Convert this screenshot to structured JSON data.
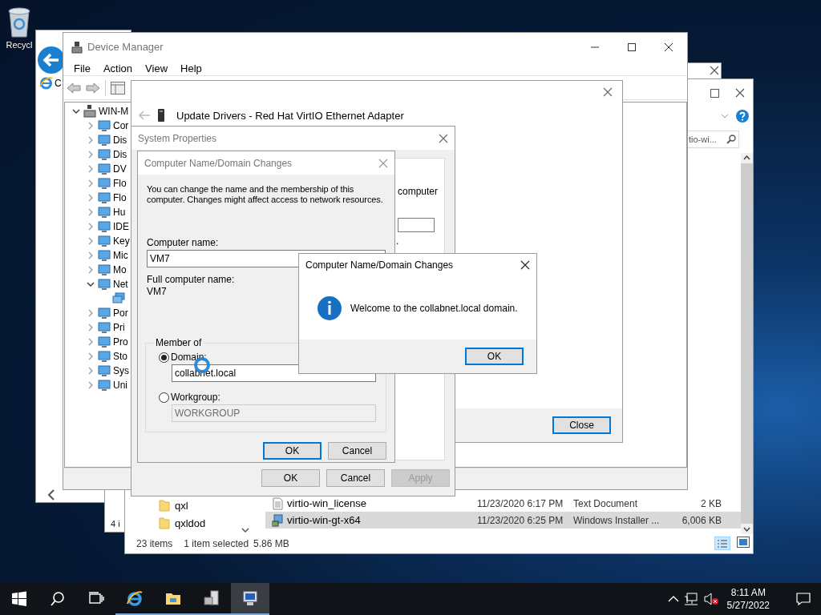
{
  "desktop": {
    "icons": [
      {
        "label": "Recycl"
      }
    ]
  },
  "back_window": {
    "address_text": "C"
  },
  "middle_window": {
    "status_text": "4 i"
  },
  "explorer": {
    "search_text": "tio-wi...",
    "folders": [
      {
        "name": "qxl"
      },
      {
        "name": "qxldod"
      }
    ],
    "files": [
      {
        "name": "virtio-win_license",
        "date": "11/23/2020 6:17 PM",
        "type": "Text Document",
        "size": "2 KB",
        "kind": "document",
        "selected": false
      },
      {
        "name": "virtio-win-gt-x64",
        "date": "11/23/2020 6:25 PM",
        "type": "Windows Installer ...",
        "size": "6,006 KB",
        "kind": "installer",
        "selected": true
      }
    ],
    "status": {
      "items": "23 items",
      "selection": "1 item selected",
      "size": "5.86 MB"
    }
  },
  "device_manager": {
    "title": "Device Manager",
    "menu": [
      "File",
      "Action",
      "View",
      "Help"
    ],
    "tree": {
      "label": "WIN-M",
      "kind": "computer",
      "expanded": true,
      "children": [
        {
          "label": "Cor",
          "kind": "category",
          "expanded": false
        },
        {
          "label": "Dis",
          "kind": "category",
          "expanded": false
        },
        {
          "label": "Dis",
          "kind": "category",
          "expanded": false
        },
        {
          "label": "DV",
          "kind": "category",
          "expanded": false
        },
        {
          "label": "Flo",
          "kind": "category",
          "expanded": false
        },
        {
          "label": "Flo",
          "kind": "category",
          "expanded": false
        },
        {
          "label": "Hu",
          "kind": "category",
          "expanded": false
        },
        {
          "label": "IDE",
          "kind": "category",
          "expanded": false
        },
        {
          "label": "Key",
          "kind": "category",
          "expanded": false
        },
        {
          "label": "Mic",
          "kind": "category",
          "expanded": false
        },
        {
          "label": "Mo",
          "kind": "category",
          "expanded": false
        },
        {
          "label": "Net",
          "kind": "category",
          "expanded": true,
          "children": [
            {
              "kind": "device"
            }
          ]
        },
        {
          "label": "Por",
          "kind": "category",
          "expanded": false
        },
        {
          "label": "Pri",
          "kind": "category",
          "expanded": false
        },
        {
          "label": "Pro",
          "kind": "category",
          "expanded": false
        },
        {
          "label": "Sto",
          "kind": "category",
          "expanded": false
        },
        {
          "label": "Sys",
          "kind": "category",
          "expanded": false
        },
        {
          "label": "Uni",
          "kind": "category",
          "expanded": false
        }
      ]
    }
  },
  "update_drivers": {
    "title": "Update Drivers - Red Hat VirtIO Ethernet Adapter",
    "button": {
      "label": "Close",
      "default": true
    }
  },
  "system_properties": {
    "title": "System Properties",
    "visible_text": "computer",
    "punctuation": ".",
    "buttons": [
      {
        "label": "OK",
        "disabled": false
      },
      {
        "label": "Cancel",
        "disabled": false
      },
      {
        "label": "Apply",
        "disabled": true
      }
    ]
  },
  "name_changes": {
    "title": "Computer Name/Domain Changes",
    "intro": "You can change the name and the membership of this computer. Changes might affect access to network resources.",
    "computer_name_label": "Computer name:",
    "computer_name": "VM7",
    "full_name_label": "Full computer name:",
    "full_name": "VM7",
    "member_of": "Member of",
    "options": [
      {
        "label": "Domain:",
        "selected": true,
        "value": "collabnet.local",
        "disabled": false
      },
      {
        "label": "Workgroup:",
        "selected": false,
        "value": "WORKGROUP",
        "disabled": true
      }
    ],
    "buttons": [
      {
        "label": "OK",
        "default": true
      },
      {
        "label": "Cancel",
        "default": false
      }
    ]
  },
  "message_box": {
    "title": "Computer Name/Domain Changes",
    "message": "Welcome to the collabnet.local domain.",
    "button": {
      "label": "OK",
      "default": true
    }
  },
  "taskbar": {
    "apps": [
      {
        "kind": "ie",
        "running": true,
        "selected": false
      },
      {
        "kind": "explorer",
        "running": true,
        "selected": false
      },
      {
        "kind": "server",
        "running": true,
        "selected": false
      },
      {
        "kind": "devices",
        "running": true,
        "selected": true
      }
    ],
    "sound_muted": true,
    "time": "8:11 AM",
    "date": "5/27/2022"
  }
}
